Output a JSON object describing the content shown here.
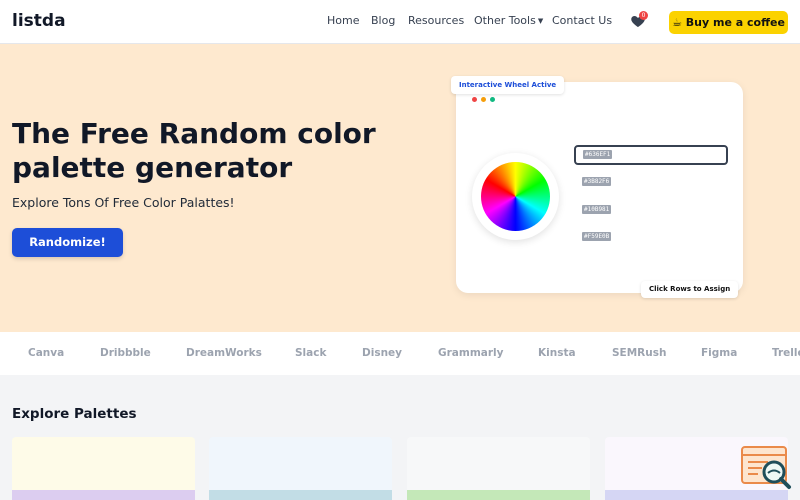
{
  "header": {
    "logo": "listda",
    "nav": {
      "home": "Home",
      "blog": "Blog",
      "resources": "Resources",
      "other_tools": "Other Tools",
      "contact": "Contact Us"
    },
    "favorites_count": "0",
    "coffee_button": "☕ Buy me a coffee"
  },
  "hero": {
    "title": "The Free Random color palette generator",
    "subtitle": "Explore Tons Of Free Color Palattes!",
    "randomize_button": "Randomize!",
    "demo": {
      "top_tag": "Interactive Wheel Active",
      "bottom_tag": "Click Rows to Assign",
      "window_dots": [
        "#ef4444",
        "#f59e0b",
        "#10b981"
      ],
      "rows": [
        "#636EF1",
        "#3B82F6",
        "#10B981",
        "#F59E0B"
      ]
    }
  },
  "brands": [
    "Canva",
    "Dribbble",
    "DreamWorks",
    "Slack",
    "Disney",
    "Grammarly",
    "Kinsta",
    "SEMRush",
    "Figma",
    "Trello"
  ],
  "explore": {
    "title": "Explore Palettes",
    "cards": [
      {
        "top": "#fefbe8",
        "bottom": "#dccdf0"
      },
      {
        "top": "#f0f6fc",
        "bottom": "#c2dde6"
      },
      {
        "top": "#f7f8f9",
        "bottom": "#c4e8b8"
      },
      {
        "top": "#faf7fd",
        "bottom": "#d5d6f4"
      }
    ]
  },
  "colors": {
    "accent": "#1d4ed8",
    "coffee": "#fbd200",
    "hero_bg": "#fee9cf"
  },
  "icons": {
    "favorites": "heart-icon",
    "fab": "code-search-icon"
  }
}
